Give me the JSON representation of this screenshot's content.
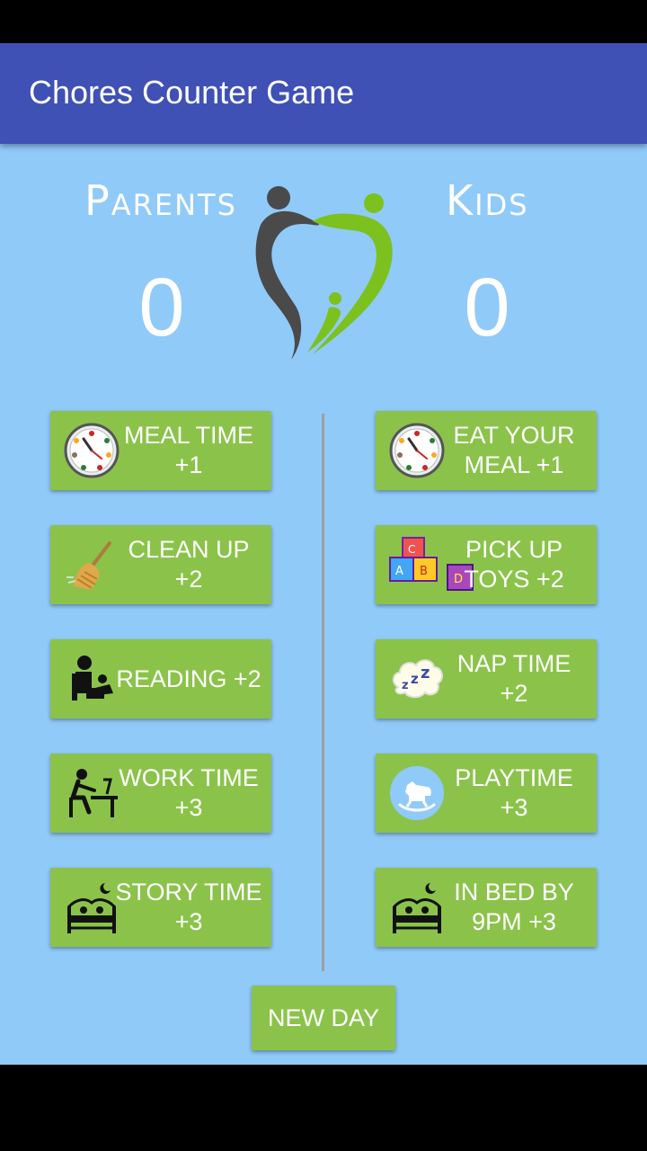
{
  "app_bar": {
    "title": "Chores Counter Game"
  },
  "scoreboard": {
    "parents": {
      "name": "Parents",
      "score": "0"
    },
    "kids": {
      "name": "Kids",
      "score": "0"
    },
    "logo_icon": "family-logo-icon"
  },
  "parents_chores": [
    {
      "label": "Meal time +1",
      "icon": "clock-icon"
    },
    {
      "label": "Clean up +2",
      "icon": "broom-icon"
    },
    {
      "label": "Reading +2",
      "icon": "reading-icon"
    },
    {
      "label": "Work time +3",
      "icon": "desk-work-icon"
    },
    {
      "label": "Story time +3",
      "icon": "bed-moon-icon"
    }
  ],
  "kids_chores": [
    {
      "label": "Eat your meal +1",
      "icon": "clock-icon"
    },
    {
      "label": "Pick up toys +2",
      "icon": "toy-blocks-icon"
    },
    {
      "label": "Nap time +2",
      "icon": "zzz-icon"
    },
    {
      "label": "Playtime +3",
      "icon": "rocking-horse-icon"
    },
    {
      "label": "In bed by 9pm +3",
      "icon": "bed-moon-icon"
    }
  ],
  "actions": {
    "new_day_label": "New day"
  },
  "colors": {
    "app_bar": "#3F51B5",
    "background": "#90CAF9",
    "button": "#8BC34A",
    "logo_dark": "#4A4A4A",
    "logo_green": "#7CC11E"
  }
}
